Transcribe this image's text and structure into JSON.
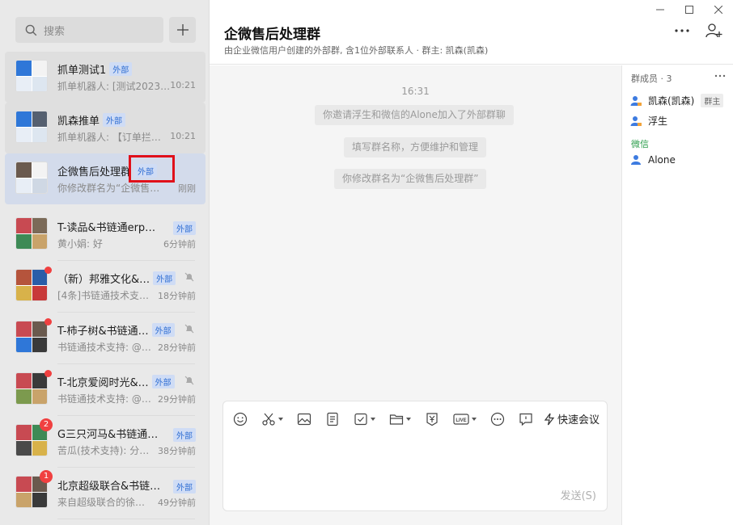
{
  "sidebar": {
    "search_placeholder": "搜索",
    "conversations": [
      {
        "name": "抓单测试1",
        "tag": "外部",
        "preview": "抓单机器人: [测试2023…",
        "time": "10:21",
        "state": "grey"
      },
      {
        "name": "凯森推单",
        "tag": "外部",
        "preview": "抓单机器人: 【订单拦…",
        "time": "10:21",
        "state": "grey"
      },
      {
        "name": "企微售后处理群",
        "tag": "外部",
        "preview": "你修改群名为“企微售…",
        "time": "刚刚",
        "state": "selected"
      },
      {
        "name": "T-读品&书链通erp…",
        "tag": "外部",
        "preview": "黄小娟: 好",
        "time": "6分钟前",
        "state": "normal"
      },
      {
        "name": "（新）邦雅文化&…",
        "tag": "外部",
        "preview": "[4条]书链通技术支…",
        "time": "18分钟前",
        "state": "normal",
        "unread_dot": true,
        "muted": true
      },
      {
        "name": "T-柿子树&书链通…",
        "tag": "外部",
        "preview": "书链通技术支持: @…",
        "time": "28分钟前",
        "state": "normal",
        "unread_dot": true,
        "muted": true
      },
      {
        "name": "T-北京爱阅时光&…",
        "tag": "外部",
        "preview": "书链通技术支持: @…",
        "time": "29分钟前",
        "state": "normal",
        "unread_dot": true,
        "muted": true
      },
      {
        "name": "G三只河马&书链通…",
        "tag": "外部",
        "preview": "苦瓜(技术支持): 分…",
        "time": "38分钟前",
        "state": "normal",
        "badge": "2"
      },
      {
        "name": "北京超级联合&书链…",
        "tag": "外部",
        "preview": "来自超级联合的徐…",
        "time": "49分钟前",
        "state": "normal",
        "badge": "1"
      }
    ]
  },
  "header": {
    "title": "企微售后处理群",
    "subtitle": "由企业微信用户创建的外部群, 含1位外部联系人 · 群主: 凯森(凯森)"
  },
  "chat": {
    "time": "16:31",
    "system_messages": [
      "你邀请浮生和微信的Alone加入了外部群聊",
      "填写群名称，方便维护和管理",
      "你修改群名为“企微售后处理群”"
    ]
  },
  "composer": {
    "meeting_label": "快速会议",
    "send_label": "发送(S)"
  },
  "members": {
    "header": "群成员 · 3",
    "list": [
      {
        "name": "凯森(凯森)",
        "role": "群主"
      },
      {
        "name": "浮生"
      }
    ],
    "wechat_label": "微信",
    "wechat_list": [
      {
        "name": "Alone"
      }
    ]
  },
  "colors": {
    "accent": "#2f6ed3",
    "selected_bg": "#d3dbeb",
    "badge": "#f04040",
    "wechat_green": "#2a9d4a"
  }
}
